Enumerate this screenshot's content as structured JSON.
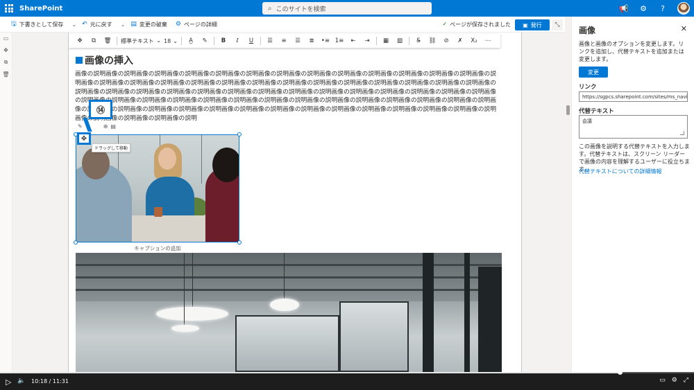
{
  "suitebar": {
    "brand": "SharePoint",
    "search_placeholder": "このサイトを検索",
    "icons": [
      "megaphone-icon",
      "gear-icon",
      "help-icon"
    ],
    "help_glyph": "?"
  },
  "command_bar": {
    "save_draft": "下書きとして保存",
    "undo": "元に戻す",
    "discard": "変更の破棄",
    "page_details": "ページの詳細",
    "saved_status": "ページが保存されました",
    "publish": "発行"
  },
  "format_toolbar": {
    "style": "標準テキスト",
    "size": "18",
    "bold": "B",
    "italic": "I",
    "underline": "U"
  },
  "content": {
    "heading": "画像の挿入",
    "body": "画像の説明画像の説明画像の説明画像の説明画像の説明画像の説明画像の説明画像の説明画像の説明画像の説明画像の説明画像の説明画像の説明画像の説明画像の説明画像の説明画像の説明画像の説明画像の説明画像の説明画像の説明画像の説明画像の説明画像の説明画像の説明画像の説明画像の説明画像の説明画像の説明画像の説明画像の説明画像の説明画像の説明画像の説明画像の説明画像の説明画像の説明画像の説明画像の説明画像の説明画像の説明画像の説明画像の説明画像の説明画像の説明画像の説明画像の説明画像の説明画像の説明画像の説明画像の説明画像の説明画像の説明画像の説明画像の説明画像の説明画像の説明画像の説明画像の説明画像の説明画像の説明画像の説明画像の説明画像の説明画像の説明画像の説明画像の説明画像の説明画像の説明画像の説明画像の説明画像の説明画像の説明",
    "callout_number": "⑭",
    "drag_tooltip": "ドラッグして移動",
    "caption_placeholder": "キャプションの追加"
  },
  "property_pane": {
    "title": "画像",
    "description": "画像と画像のオプションを変更します。リンクを追加し、代替テキストを追加または変更します。",
    "change_button": "変更",
    "link_label": "リンク",
    "link_value": "https://sgpcs.sharepoint.com/sites/ms_navi/...",
    "alt_label": "代替テキスト",
    "alt_value": "会議",
    "alt_help": "この画像を説明する代替テキストを入力します。代替テキストは、スクリーン リーダーで画像の内容を理解するユーザーに役立ちます。",
    "alt_link": "代替テキストについての詳細情報"
  },
  "player": {
    "current": "10:18",
    "separator": "/",
    "duration": "11:31",
    "progress_fraction": 0.893
  },
  "colors": {
    "accent": "#0078d4",
    "suitebar": "#0078d4"
  }
}
